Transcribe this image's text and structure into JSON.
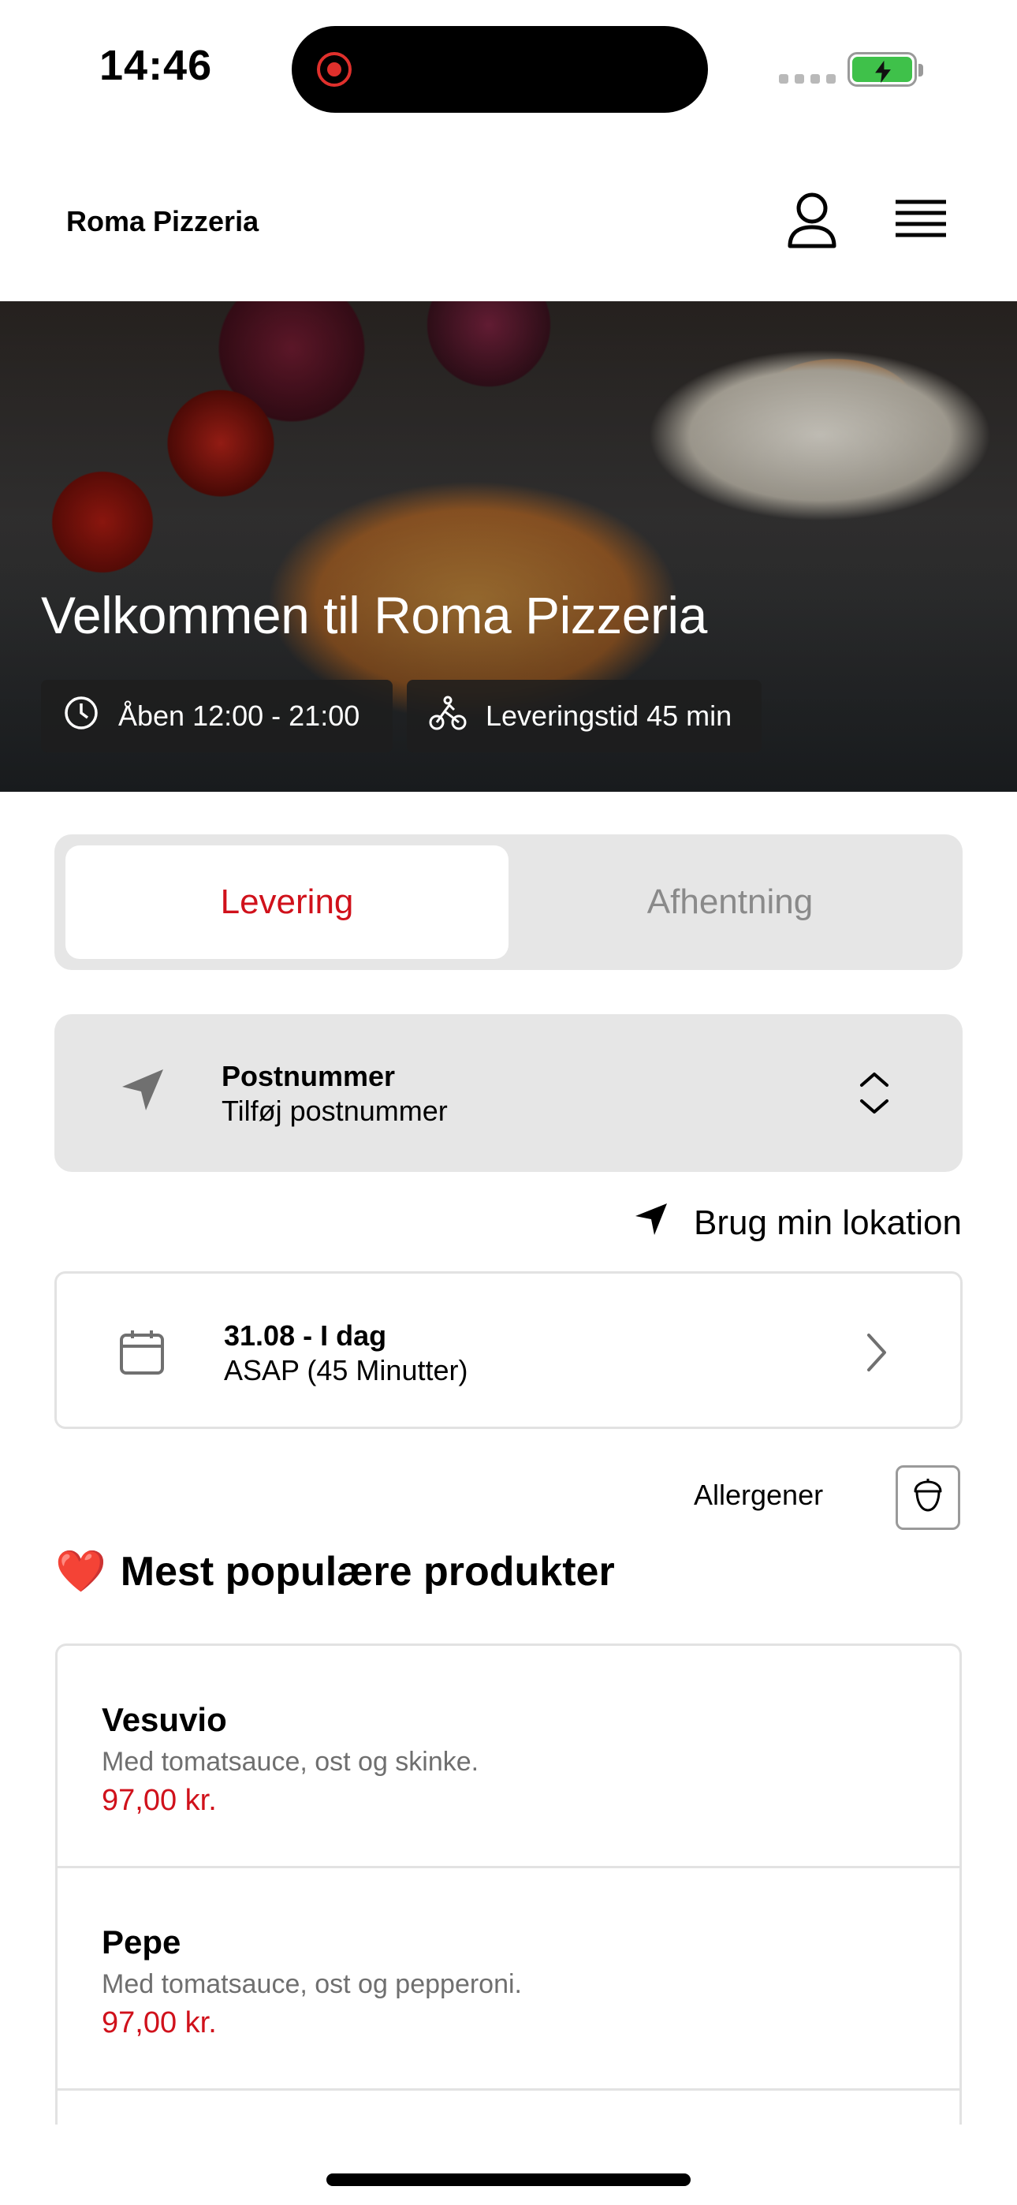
{
  "status_bar": {
    "time": "14:46"
  },
  "header": {
    "brand": "Roma Pizzeria"
  },
  "hero": {
    "title": "Velkommen til Roma Pizzeria",
    "opening_hours": "Åben 12:00 - 21:00",
    "delivery_time": "Leveringstid 45 min"
  },
  "order_mode": {
    "tabs": [
      {
        "label": "Levering",
        "selected": true
      },
      {
        "label": "Afhentning",
        "selected": false
      }
    ]
  },
  "postcode": {
    "label": "Postnummer",
    "placeholder": "Tilføj postnummer"
  },
  "use_location": {
    "label": "Brug min lokation"
  },
  "schedule": {
    "date": "31.08 - I dag",
    "time": "ASAP (45 Minutter)"
  },
  "allergens": {
    "label": "Allergener"
  },
  "popular": {
    "emoji": "❤️",
    "title": "Mest populære produkter",
    "products": [
      {
        "name": "Vesuvio",
        "description": "Med tomatsauce, ost og skinke.",
        "price": "97,00 kr."
      },
      {
        "name": "Pepe",
        "description": "Med tomatsauce, ost og pepperoni.",
        "price": "97,00 kr."
      }
    ]
  },
  "colors": {
    "accent": "#d0111b",
    "panel": "#e6e6e6",
    "battery": "#3fc14a"
  },
  "icons": [
    "record-icon",
    "battery-icon",
    "user-icon",
    "menu-icon",
    "clock-icon",
    "bike-icon",
    "navigation-arrow-icon",
    "stepper-icon",
    "calendar-icon",
    "chevron-right-icon",
    "allergen-icon"
  ]
}
